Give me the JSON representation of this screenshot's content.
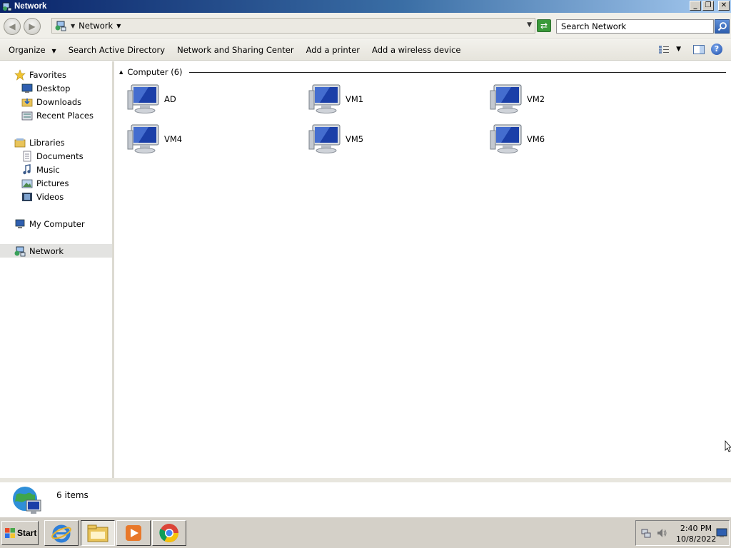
{
  "window": {
    "title": "Network",
    "controls": {
      "minimize": "_",
      "maximize": "❐",
      "close": "✕"
    }
  },
  "address_bar": {
    "breadcrumb": "Network",
    "search_placeholder": "Search Network",
    "back_icon": "back-arrow-icon",
    "forward_icon": "forward-arrow-icon",
    "refresh_icon": "refresh-icon"
  },
  "command_bar": {
    "organize": "Organize",
    "search_ad": "Search Active Directory",
    "network_center": "Network and Sharing Center",
    "add_printer": "Add a printer",
    "add_wireless": "Add a wireless device"
  },
  "nav_pane": {
    "favorites": {
      "label": "Favorites",
      "items": [
        "Desktop",
        "Downloads",
        "Recent Places"
      ]
    },
    "libraries": {
      "label": "Libraries",
      "items": [
        "Documents",
        "Music",
        "Pictures",
        "Videos"
      ]
    },
    "computer": "My Computer",
    "network": "Network"
  },
  "content": {
    "group_header": "Computer (6)",
    "computers": [
      "AD",
      "VM1",
      "VM2",
      "VM4",
      "VM5",
      "VM6"
    ]
  },
  "details_pane": {
    "item_count": "6 items"
  },
  "taskbar": {
    "start": "Start",
    "apps": [
      "internet-explorer",
      "file-explorer",
      "media-player",
      "chrome"
    ],
    "time": "2:40 PM",
    "date": "10/8/2022"
  },
  "colors": {
    "titlebar_start": "#0a246a",
    "titlebar_end": "#a6caf0",
    "selection": "#e3e3e1"
  }
}
